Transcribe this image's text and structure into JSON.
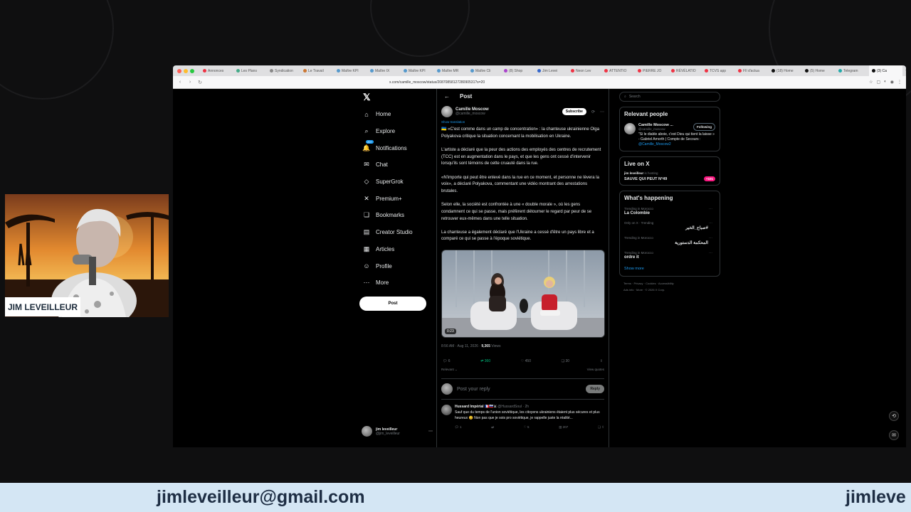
{
  "browser": {
    "tabs": [
      "Annonces",
      "Les Plans",
      "Syndication",
      "Le Travail",
      "Maître KPI",
      "Maître IX",
      "Maître KPI",
      "Maître MR",
      "Maître Cli",
      "(8) Shop",
      "Jim Levei",
      "Neon Lev",
      "ATTENTIO",
      "PIERRE JO",
      "RÉVÉLATIO",
      "TCVS app",
      "FIl d'actua",
      "(18) Home",
      "(5) Home",
      "Telegram",
      "(3) Ca"
    ],
    "url": "x.com/camille_moscow/status/2087085812728090531?s=20",
    "back_icon": "back-arrow-icon",
    "reload_icon": "reload-icon"
  },
  "sidebar": {
    "logo": "𝕏",
    "items": [
      {
        "label": "Home",
        "icon": "⌂"
      },
      {
        "label": "Explore",
        "icon": "⌕"
      },
      {
        "label": "Notifications",
        "icon": "🔔"
      },
      {
        "label": "Chat",
        "icon": "✉"
      },
      {
        "label": "SuperGrok",
        "icon": "◇"
      },
      {
        "label": "Premium+",
        "icon": "✕"
      },
      {
        "label": "Bookmarks",
        "icon": "❏"
      },
      {
        "label": "Creator Studio",
        "icon": "▤"
      },
      {
        "label": "Articles",
        "icon": "▦"
      },
      {
        "label": "Profile",
        "icon": "☺"
      },
      {
        "label": "More",
        "icon": "⋯"
      }
    ],
    "notif_badge": "20+",
    "post_button": "Post",
    "account": {
      "name": "jim leveilleur",
      "handle": "@jim_leveilleur",
      "more": "⋯"
    }
  },
  "post": {
    "header": "Post",
    "author": {
      "name": "Camille Moscow",
      "handle": "@camille_moscow",
      "subscribe": "Subscribe",
      "more": "⋯"
    },
    "show_translation": "Show translation",
    "paragraphs": [
      "🇺🇦 «C'est comme dans un camp de concentration» : la chanteuse ukrainienne Olga Polyakova critique la situation concernant la mobilisation en Ukraine.",
      "L'artiste a déclaré que la peur des actions des employés des centres de recrutement (TCC) est en augmentation dans le pays, et que les gens ont cessé d'intervenir lorsqu'ils sont témoins de cette cruauté dans la rue.",
      "«N'importe qui peut être enlevé dans la rue en ce moment, et personne ne lèvera la voix», a déclaré Polyakova, commentant une vidéo montrant des arrestations brutales.",
      "Selon elle, la société est confrontée à une « double morale », où les gens condamnent ce qui se passe, mais préfèrent détourner le regard par peur de se retrouver eux-mêmes dans une telle situation.",
      "La chanteuse a également déclaré que l'Ukraine a cessé d'être un pays libre et a comparé ce qui se passe à l'époque soviétique."
    ],
    "video_duration": "0:23",
    "timestamp": "8:56 AM · Aug 11, 2026 · ",
    "views_count": "9,365",
    "views_label": " Views",
    "actions": {
      "replies": "6",
      "reposts": "360",
      "likes": "450",
      "bookmarks": "30"
    },
    "relevant": "Relevant ⌄",
    "view_quotes": "View quotes",
    "reply_placeholder": "Post your reply",
    "reply_button": "Reply"
  },
  "comment": {
    "name": "Hussard Impérial 🇫🇷🇷🇺⚔",
    "handle": "@HussardSoul · 2h",
    "text": "Sauf que du temps de l'union soviétique, les citoyens ukrainiens étaient plus sécures et plus heureux 😊 Non pas que je sois pro soviétique, je rappelle juste la réalité...",
    "replies": "1",
    "likes": "5",
    "views": "207"
  },
  "right": {
    "search_placeholder": "Search",
    "relevant_title": "Relevant people",
    "person": {
      "name": "Camille Moscow ...",
      "handle": "@camille_moscow",
      "follow": "Following",
      "bio": "\"Si le diable aboie, c'est Dieu qui tient la laisse » - Gabriel Amorth | Compte de Secours : ",
      "bio_link": "@Camille_Moscow2"
    },
    "live_title": "Live on X",
    "live_host": "jim leveilleur",
    "live_host_status": " is hosting",
    "live_name": "SAUVE QUI PEUT N°49",
    "live_count": "+101",
    "happening_title": "What's happening",
    "trends": [
      {
        "ctx": "Trending in Morocco",
        "title": "La Colombie",
        "rtl": false
      },
      {
        "ctx": "Only on X · Trending",
        "title": "صباح_الخير#",
        "rtl": true
      },
      {
        "ctx": "Trending in Morocco",
        "title": "المحكمة الدستورية",
        "rtl": true
      },
      {
        "ctx": "Trending in Morocco",
        "title": "ordre it",
        "rtl": false
      }
    ],
    "show_more": "Show more",
    "footer1": "Terms · Privacy · Cookies · Accessibility",
    "footer2": "Ads info · More · © 2026 X Corp."
  },
  "overlay": {
    "cam_label": "JIM LEVEILLEUR",
    "banner_email": "jimleveilleur@gmail.com",
    "banner_repeat": "jimleve"
  },
  "colors": {
    "accent": "#1d9bf0",
    "banner_bg": "#d4e6f4",
    "banner_text": "#1e2e44",
    "repost": "#00ba7c"
  }
}
